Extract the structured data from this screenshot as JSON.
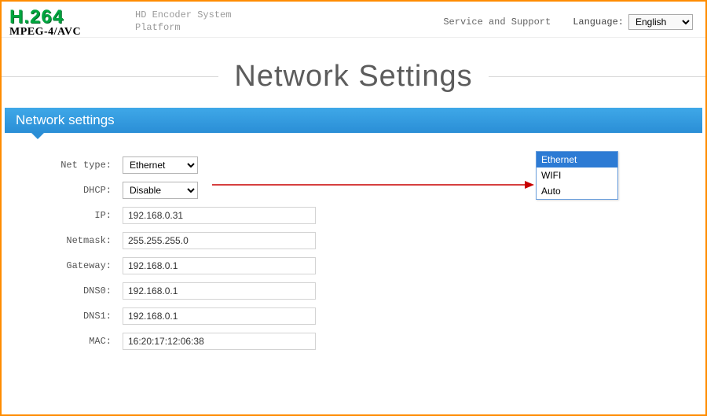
{
  "logo": {
    "main": "H.264",
    "sub": "MPEG-4/AVC"
  },
  "platform": {
    "line1": "HD Encoder System",
    "line2": "Platform"
  },
  "header": {
    "support": "Service and Support",
    "language_label": "Language:",
    "language_value": "English"
  },
  "page_title": "Network Settings",
  "section_title": "Network settings",
  "fields": {
    "net_type": {
      "label": "Net type:",
      "value": "Ethernet"
    },
    "dhcp": {
      "label": "DHCP:",
      "value": "Disable"
    },
    "ip": {
      "label": "IP:",
      "value": "192.168.0.31"
    },
    "netmask": {
      "label": "Netmask:",
      "value": "255.255.255.0"
    },
    "gateway": {
      "label": "Gateway:",
      "value": "192.168.0.1"
    },
    "dns0": {
      "label": "DNS0:",
      "value": "192.168.0.1"
    },
    "dns1": {
      "label": "DNS1:",
      "value": "192.168.0.1"
    },
    "mac": {
      "label": "MAC:",
      "value": "16:20:17:12:06:38"
    }
  },
  "net_type_options": [
    "Ethernet",
    "WIFI",
    "Auto"
  ]
}
